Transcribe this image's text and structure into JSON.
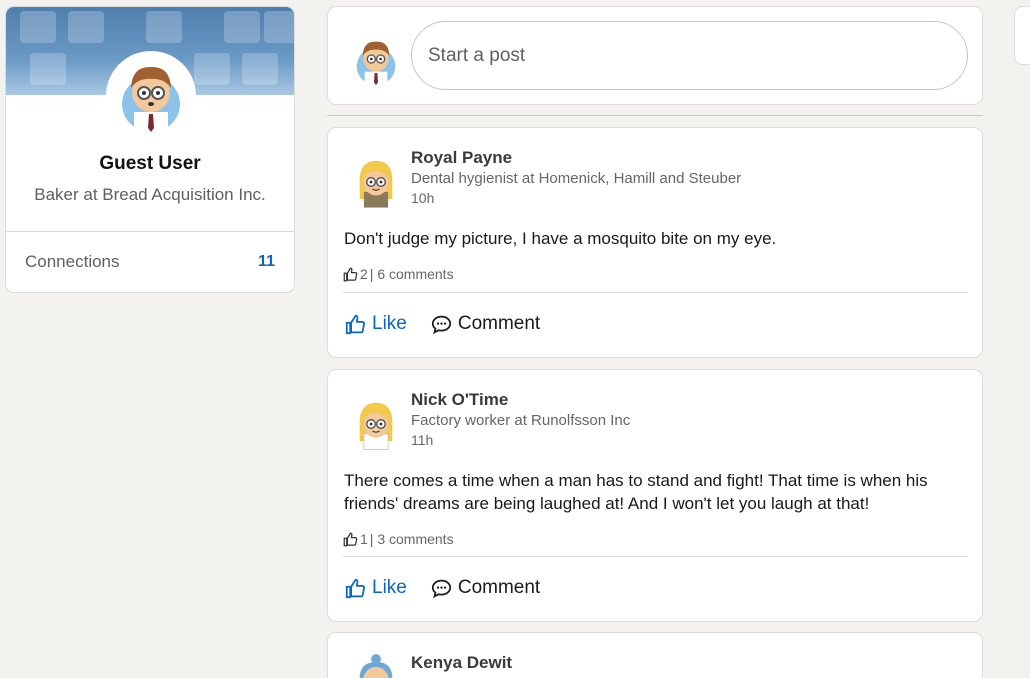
{
  "profile": {
    "name": "Guest User",
    "headline": "Baker at Bread Acquisition Inc.",
    "connections_label": "Connections",
    "connections_count": "11"
  },
  "composer": {
    "placeholder": "Start a post"
  },
  "posts": [
    {
      "author": "Royal Payne",
      "headline": "Dental hygienist at Homenick, Hamill and Steuber",
      "time": "10h",
      "text": "Don't judge my picture, I have a mosquito bite on my eye.",
      "likes": "2",
      "comments": "| 6 comments",
      "like_label": "Like",
      "comment_label": "Comment",
      "avatar_icon": "avatar-blonde-glasses-icon"
    },
    {
      "author": "Nick O'Time",
      "headline": "Factory worker at Runolfsson Inc",
      "time": "11h",
      "text": "There comes a time when a man has to stand and fight! That time is when his friends' dreams are being laughed at! And I won't let you laugh at that!",
      "likes": "1",
      "comments": "| 3 comments",
      "like_label": "Like",
      "comment_label": "Comment",
      "avatar_icon": "avatar-blonde-glasses-icon"
    },
    {
      "author": "Kenya Dewit",
      "avatar_icon": "avatar-blue-hair-icon"
    }
  ],
  "colors": {
    "background": "#f3f2ef",
    "accent": "#0a66c2",
    "card": "#ffffff"
  }
}
